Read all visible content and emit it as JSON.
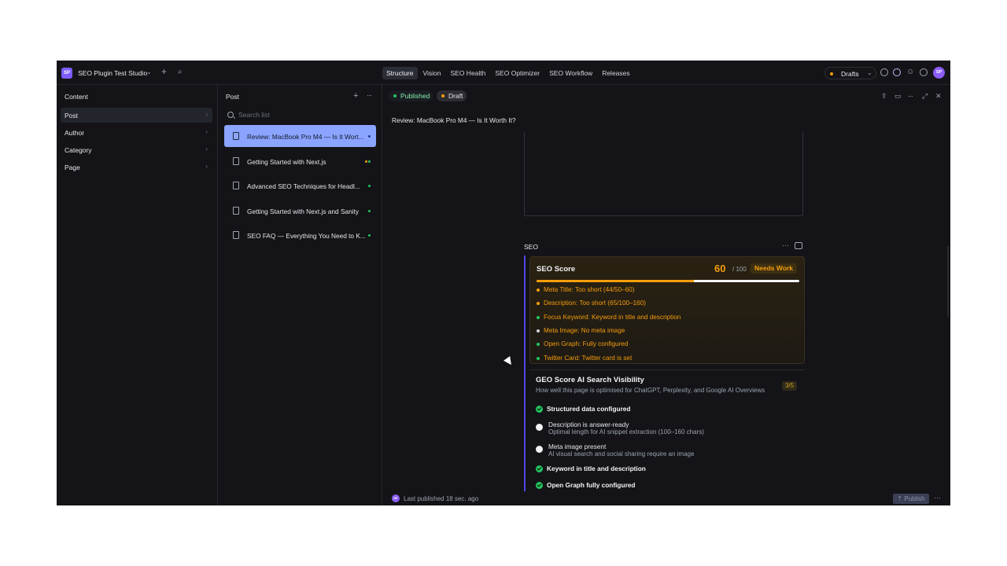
{
  "topbar": {
    "logo_text": "SP",
    "studio_name": "SEO Plugin Test Studio",
    "tabs": [
      {
        "label": "Structure",
        "active": true
      },
      {
        "label": "Vision"
      },
      {
        "label": "SEO Health"
      },
      {
        "label": "SEO Optimizer"
      },
      {
        "label": "SEO Workflow"
      },
      {
        "label": "Releases"
      }
    ],
    "perspective": "Drafts",
    "avatar_initials": "SP"
  },
  "content_pane": {
    "title": "Content",
    "items": [
      {
        "label": "Post",
        "active": true
      },
      {
        "label": "Author"
      },
      {
        "label": "Category"
      },
      {
        "label": "Page"
      }
    ]
  },
  "post_pane": {
    "title": "Post",
    "search_placeholder": "Search list",
    "documents": [
      {
        "title": "Review: MacBook Pro M4 — Is It Wort...",
        "active": true
      },
      {
        "title": "Getting Started with Next.js"
      },
      {
        "title": "Advanced SEO Techniques for Headl..."
      },
      {
        "title": "Getting Started with Next.js and Sanity"
      },
      {
        "title": "SEO FAQ — Everything You Need to K..."
      }
    ]
  },
  "document": {
    "published_label": "Published",
    "draft_label": "Draft",
    "title": "Review: MacBook Pro M4 — Is It Worth It?",
    "seo_label": "SEO",
    "seo_score": {
      "title": "SEO Score",
      "score": "60",
      "out_of": "/ 100",
      "status": "Needs Work",
      "progress": 0.6,
      "checks": [
        {
          "label": "Meta Title: Too short (44/50–60)",
          "status": "warning"
        },
        {
          "label": "Description: Too short (65/100–160)",
          "status": "warning"
        },
        {
          "label": "Focus Keyword: Keyword in title and description",
          "status": "pass"
        },
        {
          "label": "Meta Image: No meta image",
          "status": "fail"
        },
        {
          "label": "Open Graph: Fully configured",
          "status": "pass"
        },
        {
          "label": "Twitter Card: Twitter card is set",
          "status": "pass"
        }
      ]
    },
    "geo_score": {
      "title": "GEO Score AI Search Visibility",
      "subtitle": "How well this page is optimised for ChatGPT, Perplexity, and Google AI Overviews",
      "badge": "3/5",
      "items": [
        {
          "title": "Structured data configured",
          "ok": true
        },
        {
          "title": "Description is answer-ready",
          "detail": "Optimal length for AI snippet extraction (100–160 chars)",
          "ok": false
        },
        {
          "title": "Meta image present",
          "detail": "AI visual search and social sharing require an image",
          "ok": false
        },
        {
          "title": "Keyword in title and description",
          "ok": true
        },
        {
          "title": "Open Graph fully configured",
          "ok": true
        }
      ]
    },
    "footer": {
      "avatar_initials": "SP",
      "last_published": "Last published 18 sec. ago",
      "publish_label": "Publish"
    }
  },
  "colors": {
    "accent": "#8ba4ff",
    "warning": "#f59e0b",
    "success": "#22c55e",
    "brand": "#7c5cff"
  }
}
